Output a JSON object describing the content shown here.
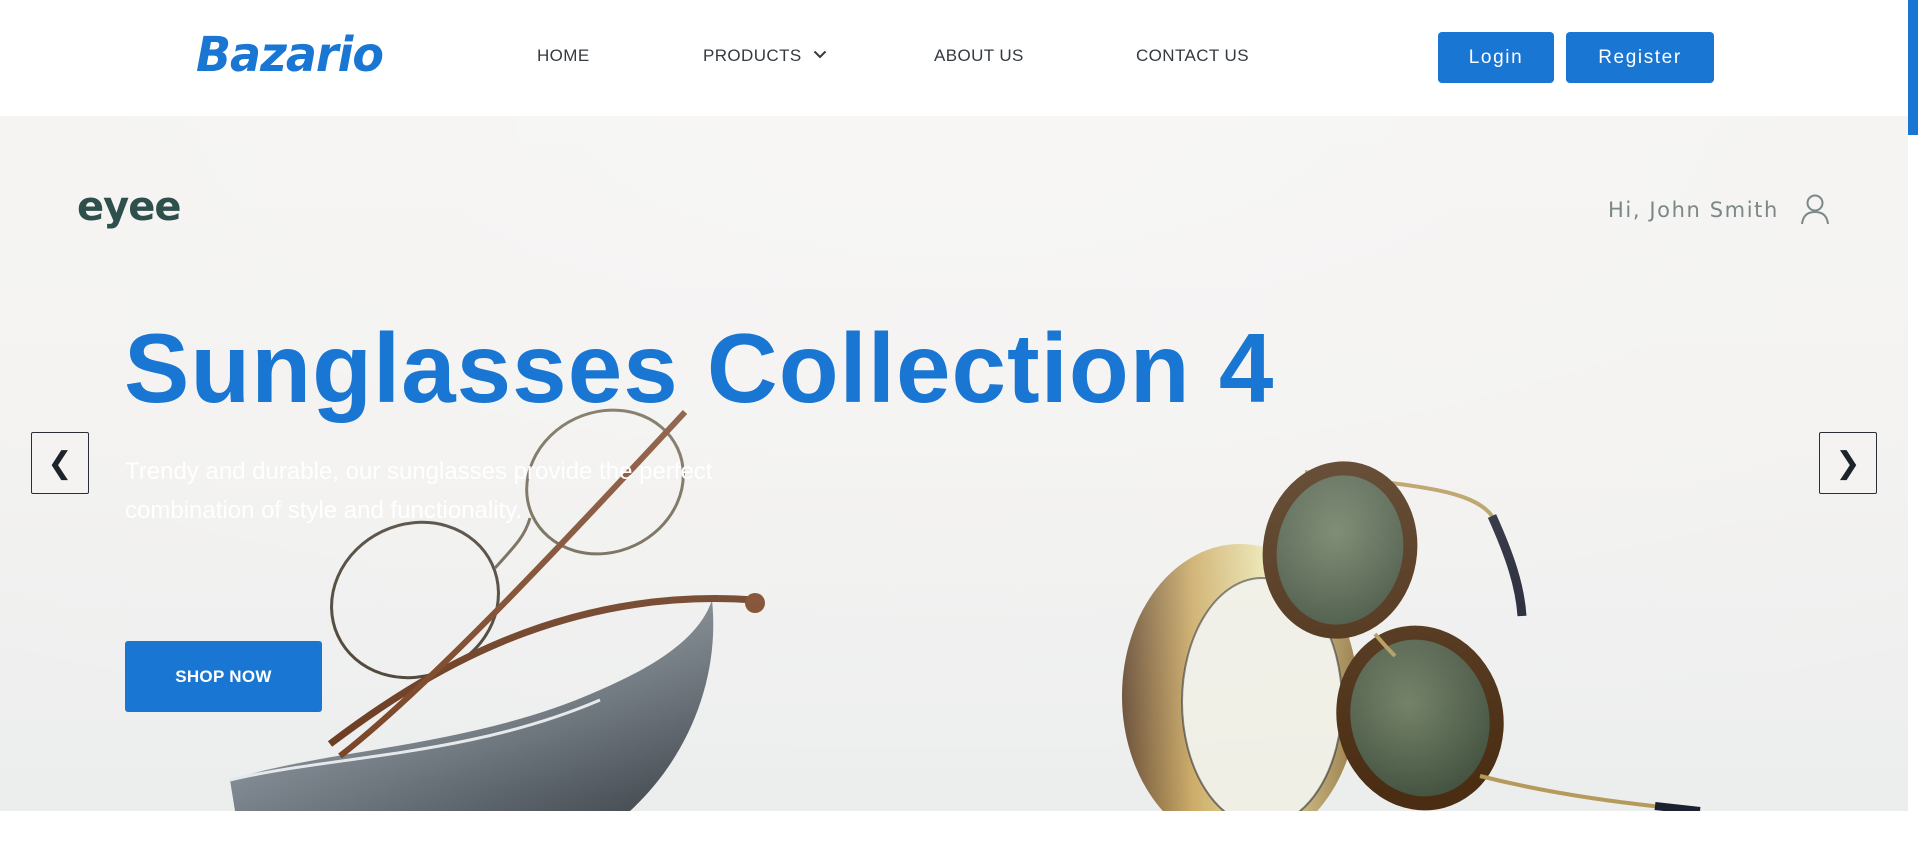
{
  "header": {
    "logo": "Bazario",
    "nav": [
      {
        "label": "HOME"
      },
      {
        "label": "PRODUCTS",
        "icon": "chevron-down-icon"
      },
      {
        "label": "ABOUT US"
      },
      {
        "label": "CONTACT US"
      }
    ],
    "login_label": "Login",
    "register_label": "Register"
  },
  "hero": {
    "brand": "eyee",
    "greeting": "Hi, John Smith",
    "user_icon": "user-icon",
    "title": "Sunglasses Collection 4",
    "description": "Trendy and durable, our sunglasses provide the perfect combination of style and functionality.",
    "cta_label": "SHOP NOW",
    "prev_label": "❮",
    "next_label": "❯"
  },
  "colors": {
    "accent": "#1976d2",
    "hero_background": "#f2f1ef",
    "brand_text": "#2f4f4d"
  }
}
